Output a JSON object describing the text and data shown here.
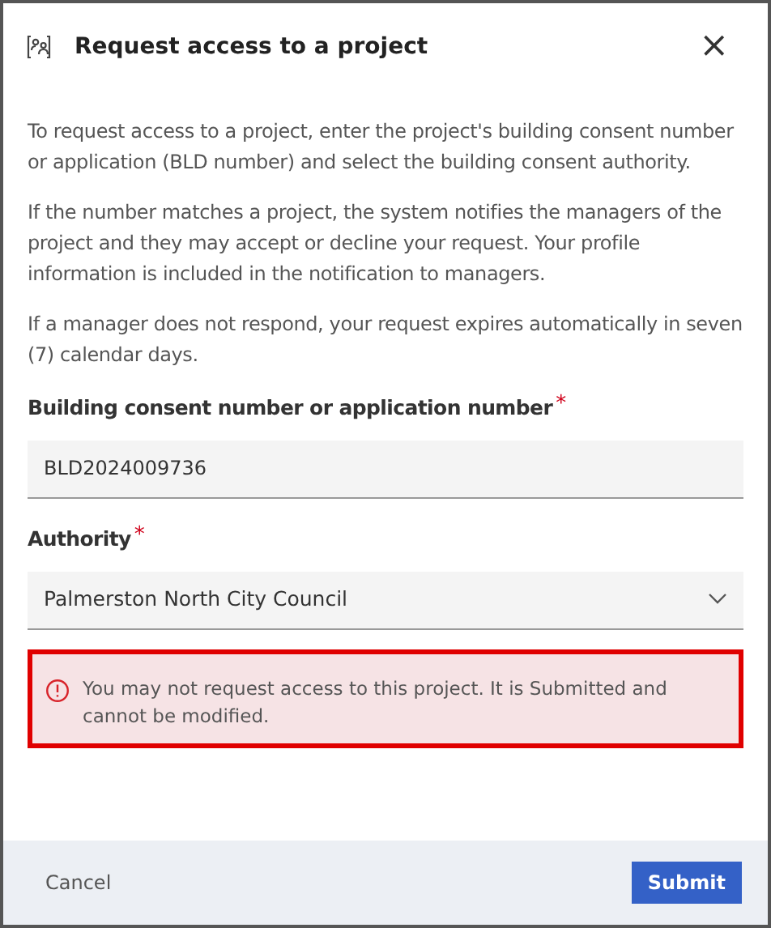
{
  "dialog": {
    "title": "Request access to a project",
    "close": "×"
  },
  "paragraphs": [
    "To request access to a project, enter the project's building consent number or application (BLD number) and select the building consent authority.",
    "If the number matches a project, the system notifies the managers of the project and they may accept or decline your request. Your profile information is included in the notification to managers.",
    "If a manager does not respond, your request expires automatically in seven (7) calendar days."
  ],
  "fields": [
    {
      "kind": "text",
      "label": "Building consent number or application number",
      "required_mark": "*",
      "value": "BLD2024009736"
    },
    {
      "kind": "select",
      "label": "Authority",
      "required_mark": "*",
      "value": "Palmerston North City Council"
    }
  ],
  "error": {
    "message": "You may not request access to this project. It is Submitted and cannot be modified."
  },
  "buttons": {
    "cancel": "Cancel",
    "submit": "Submit"
  }
}
